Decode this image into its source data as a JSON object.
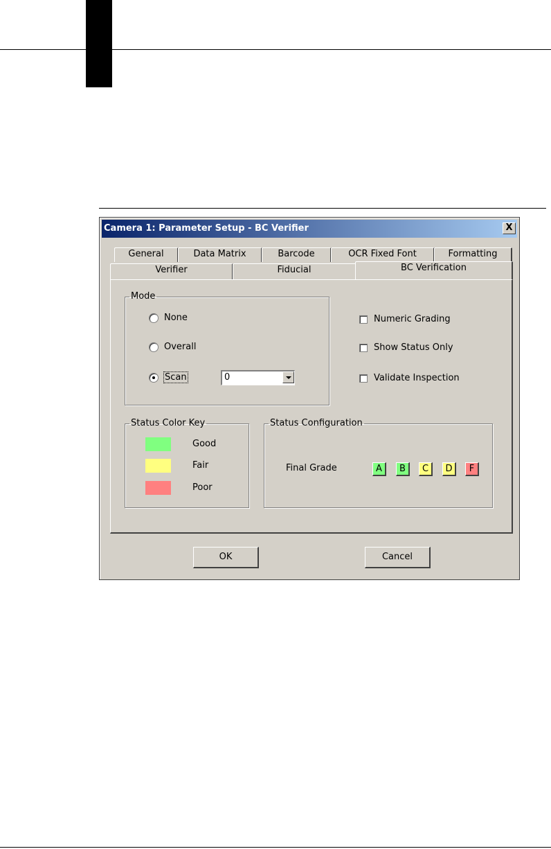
{
  "dialog": {
    "title": "Camera 1: Parameter Setup - BC Verifier",
    "close_label": "X"
  },
  "tabs": {
    "back_row": [
      "General",
      "Data Matrix",
      "Barcode",
      "OCR Fixed Font",
      "Formatting"
    ],
    "front_row": [
      "Verifier",
      "Fiducial",
      "BC Verification"
    ],
    "active": "BC Verification"
  },
  "mode_group": {
    "legend": "Mode",
    "options": [
      {
        "label": "None",
        "selected": false
      },
      {
        "label": "Overall",
        "selected": false
      },
      {
        "label": "Scan",
        "selected": true
      }
    ],
    "scan_value": "0"
  },
  "options": {
    "numeric_grading": {
      "label": "Numeric Grading",
      "checked": false
    },
    "show_status_only": {
      "label": "Show Status Only",
      "checked": false
    },
    "validate_inspection": {
      "label": "Validate Inspection",
      "checked": false
    }
  },
  "status_color_key": {
    "legend": "Status Color Key",
    "items": [
      {
        "label": "Good",
        "color": "#80ff80"
      },
      {
        "label": "Fair",
        "color": "#ffff80"
      },
      {
        "label": "Poor",
        "color": "#ff8080"
      }
    ]
  },
  "status_configuration": {
    "legend": "Status Configuration",
    "final_grade_label": "Final Grade",
    "grades": [
      {
        "label": "A",
        "color": "#80ff80"
      },
      {
        "label": "B",
        "color": "#80ff80"
      },
      {
        "label": "C",
        "color": "#ffff80"
      },
      {
        "label": "D",
        "color": "#ffff80"
      },
      {
        "label": "F",
        "color": "#ff8080"
      }
    ]
  },
  "buttons": {
    "ok": "OK",
    "cancel": "Cancel"
  },
  "colors": {
    "dialog_face": "#d4d0c8",
    "titlebar_start": "#0a246a",
    "titlebar_end": "#a6caf0"
  }
}
